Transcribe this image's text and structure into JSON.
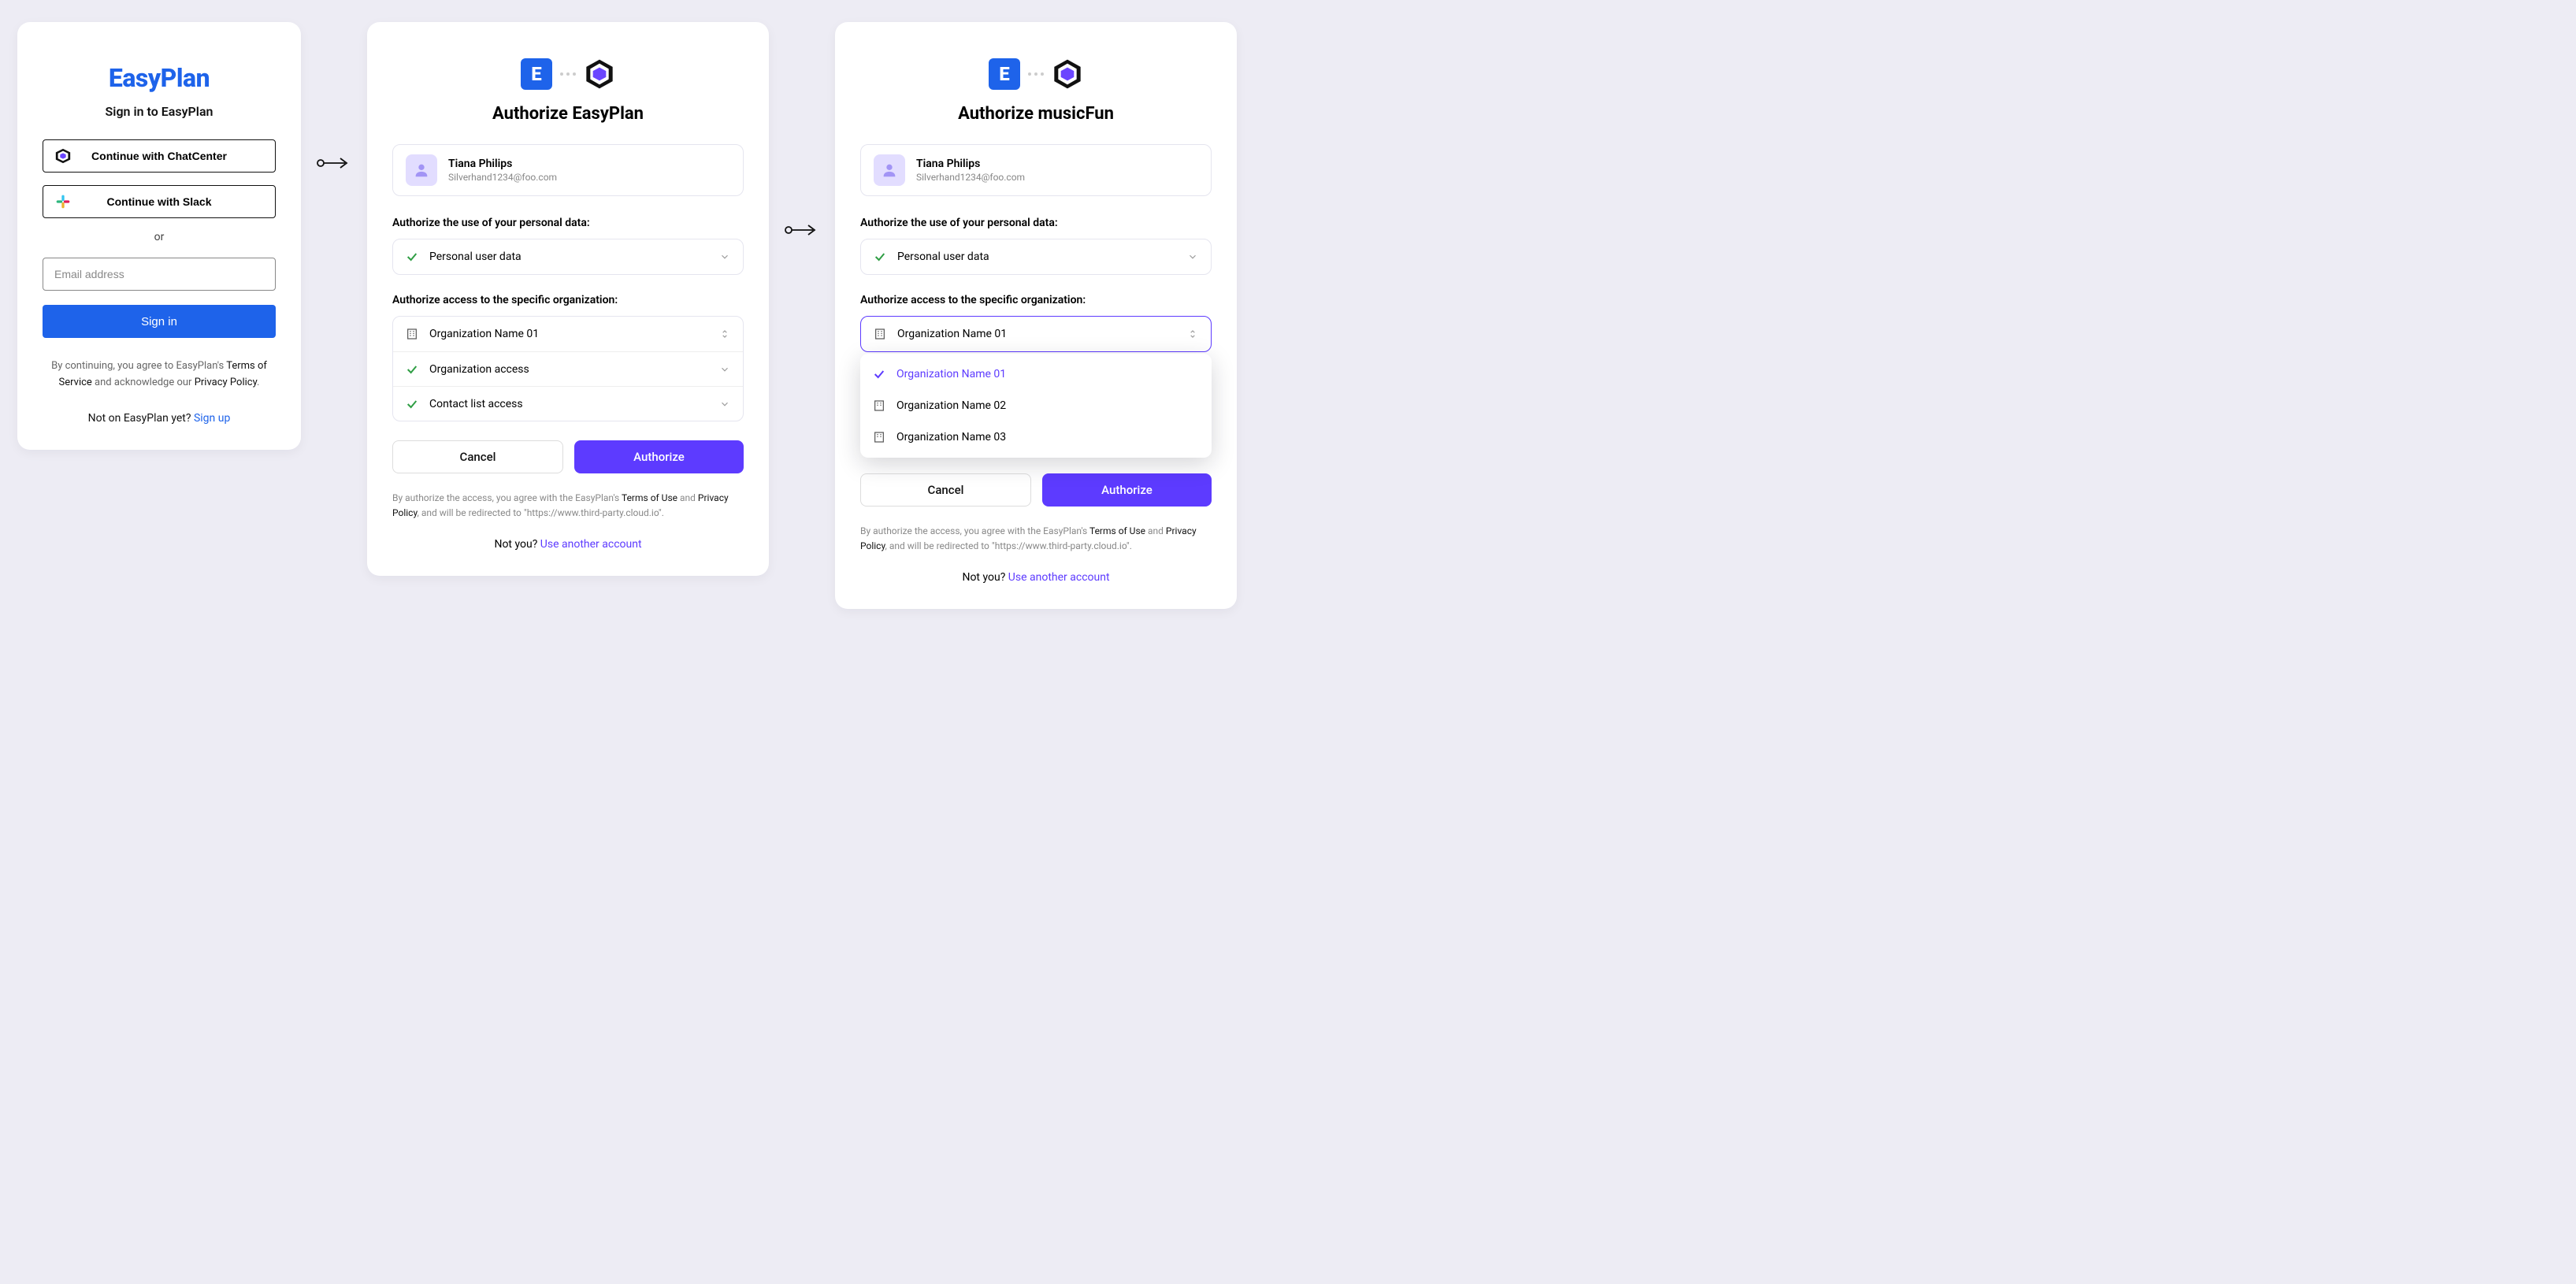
{
  "signin": {
    "brand": "EasyPlan",
    "title": "Sign in to EasyPlan",
    "chatcenter_label": "Continue with ChatCenter",
    "slack_label": "Continue with Slack",
    "or": "or",
    "email_placeholder": "Email address",
    "signin_label": "Sign in",
    "agree_pre": "By continuing, you agree to EasyPlan's ",
    "terms": "Terms of Service",
    "agree_mid": " and acknowledge our ",
    "privacy": "Privacy Policy",
    "agree_post": ".",
    "signup_pre": "Not on EasyPlan yet? ",
    "signup": "Sign up"
  },
  "auth1": {
    "title": "Authorize EasyPlan",
    "user_name": "Tiana Philips",
    "user_email": "Silverhand1234@foo.com",
    "section_personal": "Authorize the use of your personal data:",
    "perm_personal": "Personal user data",
    "section_org": "Authorize access to the specific organization:",
    "org_selected": "Organization Name 01",
    "perm_org_access": "Organization access",
    "perm_contact": "Contact list access",
    "cancel": "Cancel",
    "authorize": "Authorize",
    "disc_pre": "By authorize the access, you agree with the EasyPlan's ",
    "terms": "Terms of Use",
    "disc_mid": " and ",
    "privacy": "Privacy Policy",
    "disc_post": ", and will be redirected to \"https://www.third-party.cloud.io\".",
    "notyou_pre": "Not you? ",
    "notyou_link": "Use another account"
  },
  "auth2": {
    "title": "Authorize musicFun",
    "user_name": "Tiana Philips",
    "user_email": "Silverhand1234@foo.com",
    "section_personal": "Authorize the use of your personal data:",
    "perm_personal": "Personal user data",
    "section_org": "Authorize access to the specific organization:",
    "org_selected": "Organization Name 01",
    "dd_options": [
      "Organization Name 01",
      "Organization Name 02",
      "Organization Name 03"
    ],
    "cancel": "Cancel",
    "authorize": "Authorize",
    "disc_pre": "By authorize the access, you agree with the EasyPlan's ",
    "terms": "Terms of Use",
    "disc_mid": " and ",
    "privacy": "Privacy Policy",
    "disc_post": ", and will be redirected to \"https://www.third-party.cloud.io\".",
    "notyou_pre": "Not you? ",
    "notyou_link": "Use another account"
  }
}
